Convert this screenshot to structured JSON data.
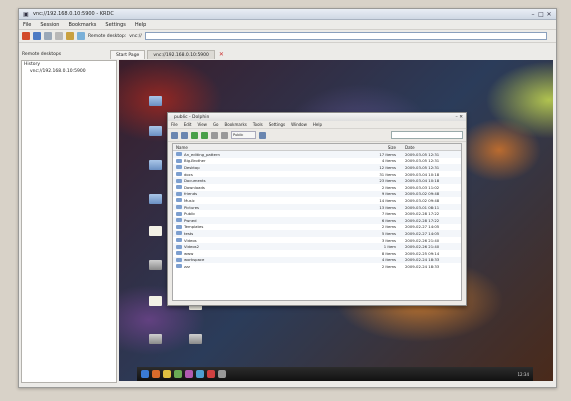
{
  "window": {
    "title": "vnc://192.168.0.10:5900 - KRDC"
  },
  "menubar": [
    "File",
    "Session",
    "Bookmarks",
    "Settings",
    "Help"
  ],
  "toolbar": {
    "remote_label": "Remote desktop:",
    "protocol": "vnc://"
  },
  "sidebar": {
    "header": "Remote desktops",
    "items": [
      "History",
      "vnc://192.168.0.10:5900"
    ]
  },
  "tabs": [
    {
      "label": "Start Page"
    },
    {
      "label": "vnc://192.168.0.10:5900"
    }
  ],
  "remote": {
    "filemanager": {
      "title": "public - Dolphin",
      "menu": [
        "File",
        "Edit",
        "View",
        "Go",
        "Bookmarks",
        "Tools",
        "Settings",
        "Window",
        "Help"
      ],
      "path": "Public",
      "columns": [
        "Name",
        "Size",
        "Date"
      ],
      "rows": [
        {
          "name": "An_editing_pattern",
          "size": "17 items",
          "date": "2009-03-05 12:31"
        },
        {
          "name": "Big-Brother",
          "size": "4 items",
          "date": "2009-03-05 12:31"
        },
        {
          "name": "Desktop",
          "size": "12 items",
          "date": "2009-03-05 12:31"
        },
        {
          "name": "docs",
          "size": "31 items",
          "date": "2009-03-04 10:18"
        },
        {
          "name": "Documents",
          "size": "23 items",
          "date": "2009-03-04 10:18"
        },
        {
          "name": "Downloads",
          "size": "2 items",
          "date": "2009-03-03 11:02"
        },
        {
          "name": "friends",
          "size": "9 items",
          "date": "2009-03-02 09:48"
        },
        {
          "name": "Music",
          "size": "14 items",
          "date": "2009-03-02 09:48"
        },
        {
          "name": "Pictures",
          "size": "13 items",
          "date": "2009-03-01 08:11"
        },
        {
          "name": "Public",
          "size": "7 items",
          "date": "2009-02-28 17:22"
        },
        {
          "name": "Pwned",
          "size": "6 items",
          "date": "2009-02-28 17:22"
        },
        {
          "name": "Templates",
          "size": "2 items",
          "date": "2009-02-27 14:05"
        },
        {
          "name": "tests",
          "size": "5 items",
          "date": "2009-02-27 14:05"
        },
        {
          "name": "Videos",
          "size": "3 items",
          "date": "2009-02-26 21:40"
        },
        {
          "name": "Videos2",
          "size": "1 item",
          "date": "2009-02-26 21:40"
        },
        {
          "name": "www",
          "size": "8 items",
          "date": "2009-02-25 09:14"
        },
        {
          "name": "workspace",
          "size": "4 items",
          "date": "2009-02-24 18:33"
        },
        {
          "name": "zzz",
          "size": "2 items",
          "date": "2009-02-24 18:33"
        }
      ]
    },
    "taskbar_clock": "12:34"
  }
}
